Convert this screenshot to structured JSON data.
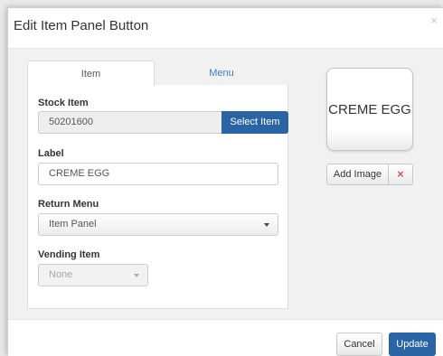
{
  "modal": {
    "title": "Edit Item Panel Button",
    "close_symbol": "×"
  },
  "tabs": [
    {
      "label": "Item",
      "active": true
    },
    {
      "label": "Menu",
      "active": false
    }
  ],
  "form": {
    "stock_item": {
      "label": "Stock Item",
      "value": "50201600",
      "button_label": "Select Item"
    },
    "label_field": {
      "label": "Label",
      "value": "CREME EGG"
    },
    "return_menu": {
      "label": "Return Menu",
      "selected": "Item Panel"
    },
    "vending_item": {
      "label": "Vending Item",
      "selected": "None"
    }
  },
  "preview": {
    "text": "CREME EGG",
    "add_image_label": "Add Image",
    "remove_symbol": "×"
  },
  "footer": {
    "cancel_label": "Cancel",
    "update_label": "Update"
  },
  "colors": {
    "primary": "#2a64a5",
    "link": "#3e7cc4",
    "danger": "#d9534f"
  }
}
